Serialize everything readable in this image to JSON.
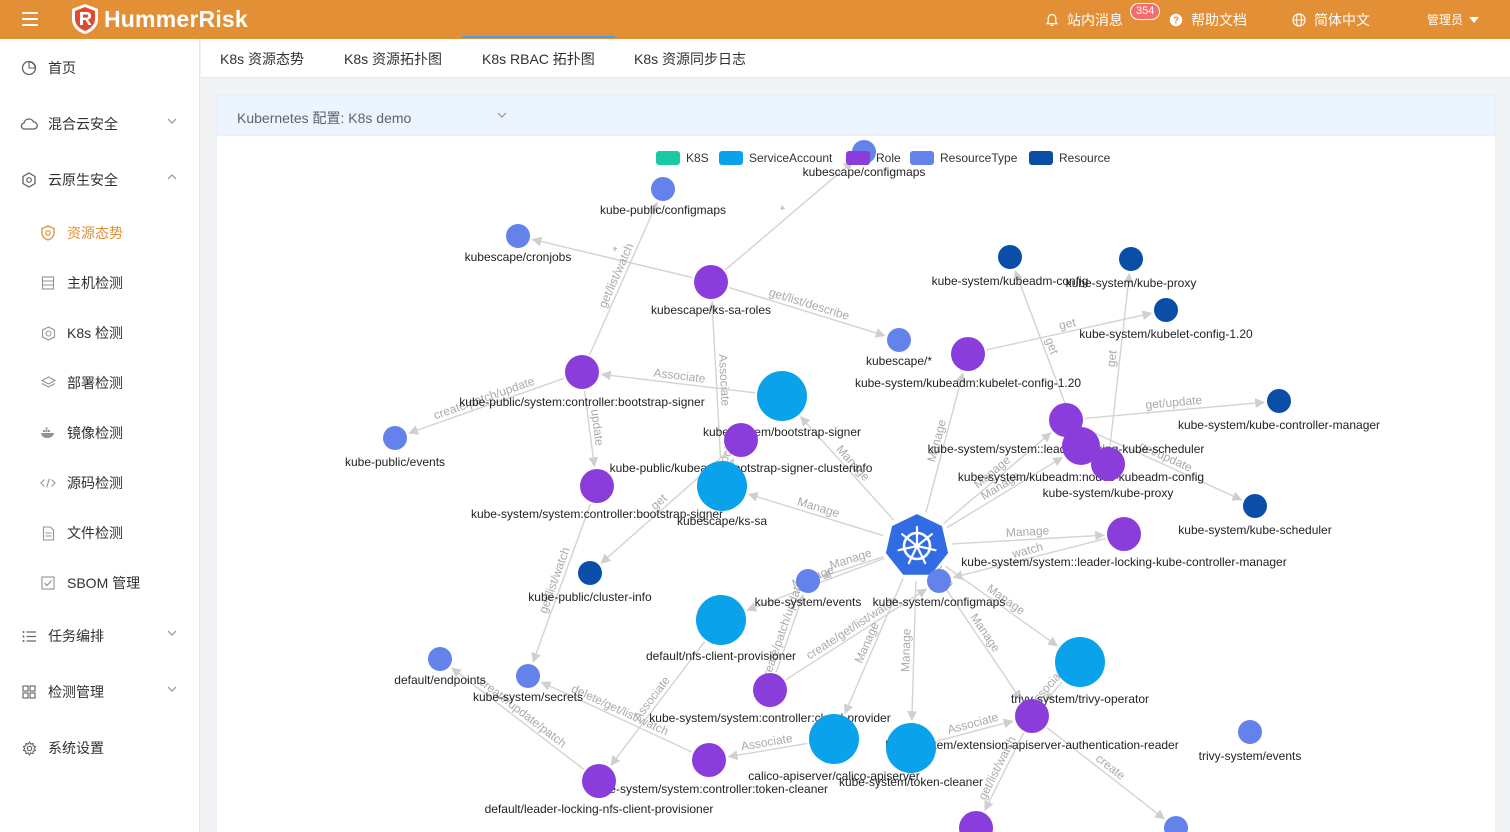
{
  "header": {
    "brand": "HummerRisk",
    "messages_label": "站内消息",
    "messages_badge": "354",
    "help_label": "帮助文档",
    "lang_label": "简体中文",
    "user_label": "管理员"
  },
  "sidebar": {
    "items": [
      {
        "label": "首页",
        "icon": "home-icon"
      },
      {
        "label": "混合云安全",
        "icon": "cloud-icon"
      },
      {
        "label": "云原生安全",
        "icon": "cloud-native-icon"
      },
      {
        "label": "资源态势",
        "icon": "shield-icon",
        "active": true
      },
      {
        "label": "主机检测",
        "icon": "server-icon"
      },
      {
        "label": "K8s 检测",
        "icon": "k8s-icon"
      },
      {
        "label": "部署检测",
        "icon": "layers-icon"
      },
      {
        "label": "镜像检测",
        "icon": "docker-icon"
      },
      {
        "label": "源码检测",
        "icon": "code-icon"
      },
      {
        "label": "文件检测",
        "icon": "file-icon"
      },
      {
        "label": "SBOM 管理",
        "icon": "checkbox-icon"
      },
      {
        "label": "任务编排",
        "icon": "list-icon"
      },
      {
        "label": "检测管理",
        "icon": "grid-icon"
      },
      {
        "label": "系统设置",
        "icon": "gear-icon"
      }
    ]
  },
  "tabs": [
    {
      "label": "K8s 资源态势"
    },
    {
      "label": "K8s 资源拓扑图"
    },
    {
      "label": "K8s RBAC 拓扑图",
      "active": true
    },
    {
      "label": "K8s 资源同步日志"
    }
  ],
  "panel": {
    "config_label": "Kubernetes 配置: K8s demo"
  },
  "colors": {
    "header": "#e38f35",
    "K8S": "#1bc8a4",
    "ServiceAccount": "#0aa2ea",
    "Role": "#8a3ddb",
    "ResourceType": "#6482eb",
    "Resource": "#0a4ea8"
  },
  "graph": {
    "legend": [
      "K8S",
      "ServiceAccount",
      "Role",
      "ResourceType",
      "Resource"
    ],
    "nodes": [
      {
        "id": "k8s",
        "cat": "K8S",
        "label": ""
      },
      {
        "id": "kubescape-configmaps",
        "cat": "ResourceType",
        "label": "kubescape/configmaps"
      },
      {
        "id": "kube-public-configmaps",
        "cat": "ResourceType",
        "label": "kube-public/configmaps"
      },
      {
        "id": "kubescape-cronjobs",
        "cat": "ResourceType",
        "label": "kubescape/cronjobs"
      },
      {
        "id": "kubescape-ks-sa-roles",
        "cat": "Role",
        "label": "kubescape/ks-sa-roles"
      },
      {
        "id": "kubescape-star",
        "cat": "ResourceType",
        "label": "kubescape/*"
      },
      {
        "id": "kubeadm-kubelet-config",
        "cat": "Role",
        "label": "kube-system/kubeadm:kubelet-config-1.20"
      },
      {
        "id": "kube-system-kubeadm-config",
        "cat": "Resource",
        "label": "kube-system/kubeadm-config"
      },
      {
        "id": "kube-system-kube-proxy-res",
        "cat": "Resource",
        "label": "kube-system/kube-proxy"
      },
      {
        "id": "kube-system-kubelet-config",
        "cat": "Resource",
        "label": "kube-system/kubelet-config-1.20"
      },
      {
        "id": "bootstrap-signer-role",
        "cat": "Role",
        "label": "kube-public/system:controller:bootstrap-signer"
      },
      {
        "id": "kube-public-events",
        "cat": "ResourceType",
        "label": "kube-public/events"
      },
      {
        "id": "kube-system-bootstrap-signer",
        "cat": "ServiceAccount",
        "label": "kube-system/bootstrap-signer"
      },
      {
        "id": "bootstrap-signer-clusterinfo",
        "cat": "Role",
        "label": "kube-public/kubeadm:bootstrap-signer-clusterinfo"
      },
      {
        "id": "kube-system-bootstrap-signer-role",
        "cat": "Role",
        "label": "kube-system/system:controller:bootstrap-signer"
      },
      {
        "id": "kubescape-ks-sa",
        "cat": "ServiceAccount",
        "label": "kubescape/ks-sa"
      },
      {
        "id": "kube-public-cluster-info",
        "cat": "Resource",
        "label": "kube-public/cluster-info"
      },
      {
        "id": "leader-locking-kube-scheduler",
        "cat": "Role",
        "label": "kube-system/system::leader-locking-kube-scheduler"
      },
      {
        "id": "kubeadm-nodes-config",
        "cat": "Role",
        "label": "kube-system/kubeadm:nodes-kubeadm-config"
      },
      {
        "id": "kube-system-kube-proxy-role",
        "cat": "Role",
        "label": "kube-system/kube-proxy"
      },
      {
        "id": "kube-controller-manager",
        "cat": "Resource",
        "label": "kube-system/kube-controller-manager"
      },
      {
        "id": "kube-scheduler",
        "cat": "Resource",
        "label": "kube-system/kube-scheduler"
      },
      {
        "id": "leader-locking-kcm",
        "cat": "Role",
        "label": "kube-system/system::leader-locking-kube-controller-manager"
      },
      {
        "id": "kube-system-events",
        "cat": "ResourceType",
        "label": "kube-system/events"
      },
      {
        "id": "kube-system-configmaps",
        "cat": "ResourceType",
        "label": "kube-system/configmaps"
      },
      {
        "id": "nfs-client-provisioner",
        "cat": "ServiceAccount",
        "label": "default/nfs-client-provisioner"
      },
      {
        "id": "default-endpoints",
        "cat": "ResourceType",
        "label": "default/endpoints"
      },
      {
        "id": "kube-system-secrets",
        "cat": "ResourceType",
        "label": "kube-system/secrets"
      },
      {
        "id": "cloud-provider",
        "cat": "Role",
        "label": "kube-system/system:controller:cloud-provider"
      },
      {
        "id": "trivy-operator",
        "cat": "ServiceAccount",
        "label": "trivy-system/trivy-operator"
      },
      {
        "id": "extension-apiserver-auth",
        "cat": "Role",
        "label": "kube-system/extension-apiserver-authentication-reader"
      },
      {
        "id": "calico-apiserver",
        "cat": "ServiceAccount",
        "label": "calico-apiserver/calico-apiserver"
      },
      {
        "id": "token-cleaner",
        "cat": "ServiceAccount",
        "label": "kube-system/token-cleaner"
      },
      {
        "id": "token-cleaner-role",
        "cat": "Role",
        "label": "kube-system/system:controller:token-cleaner"
      },
      {
        "id": "leader-locking-nfs",
        "cat": "Role",
        "label": "default/leader-locking-nfs-client-provisioner"
      },
      {
        "id": "trivy-events",
        "cat": "ResourceType",
        "label": "trivy-system/events"
      },
      {
        "id": "bottom-role-1",
        "cat": "Role",
        "label": ""
      },
      {
        "id": "bottom-resourcetype-1",
        "cat": "ResourceType",
        "label": ""
      }
    ],
    "edges": [
      {
        "from": "kubescape-ks-sa-roles",
        "to": "kubescape-configmaps",
        "label": "*"
      },
      {
        "from": "kubescape-ks-sa-roles",
        "to": "kubescape-cronjobs",
        "label": "*"
      },
      {
        "from": "kubescape-ks-sa-roles",
        "to": "kubescape-star",
        "label": "get/list/describe"
      },
      {
        "from": "bootstrap-signer-role",
        "to": "kube-public-configmaps",
        "label": "get/list/watch"
      },
      {
        "from": "bootstrap-signer-role",
        "to": "kube-public-events",
        "label": "create/patch/update"
      },
      {
        "from": "kube-system-bootstrap-signer",
        "to": "bootstrap-signer-role",
        "label": "Associate"
      },
      {
        "from": "kubescape-ks-sa",
        "to": "kubescape-ks-sa-roles",
        "label": "Associate"
      },
      {
        "from": "kubescape-ks-sa",
        "to": "bootstrap-signer-clusterinfo",
        "label": "Associate"
      },
      {
        "from": "kubeadm-kubelet-config",
        "to": "kube-system-kubelet-config",
        "label": "get"
      },
      {
        "from": "kubeadm-nodes-config",
        "to": "kube-system-kubeadm-config",
        "label": "get"
      },
      {
        "from": "kube-system-kube-proxy-role",
        "to": "kube-system-kube-proxy-res",
        "label": "get"
      },
      {
        "from": "bootstrap-signer-role",
        "to": "kube-system-bootstrap-signer-role",
        "label": "update"
      },
      {
        "from": "bootstrap-signer-clusterinfo",
        "to": "kube-public-cluster-info",
        "label": "get"
      },
      {
        "from": "kube-system-bootstrap-signer-role",
        "to": "kube-system-secrets",
        "label": "get/list/watch"
      },
      {
        "from": "k8s",
        "to": "kube-system-bootstrap-signer",
        "label": "Manage"
      },
      {
        "from": "k8s",
        "to": "kubescape-ks-sa",
        "label": "Manage"
      },
      {
        "from": "k8s",
        "to": "kubeadm-kubelet-config",
        "label": "Manage"
      },
      {
        "from": "k8s",
        "to": "leader-locking-kube-scheduler",
        "label": "Manage"
      },
      {
        "from": "k8s",
        "to": "kubeadm-nodes-config",
        "label": "Manage"
      },
      {
        "from": "k8s",
        "to": "leader-locking-kcm",
        "label": "Manage"
      },
      {
        "from": "k8s",
        "to": "kube-system-events",
        "label": "Manage"
      },
      {
        "from": "k8s",
        "to": "nfs-client-provisioner",
        "label": "Manage"
      },
      {
        "from": "k8s",
        "to": "calico-apiserver",
        "label": "Manage"
      },
      {
        "from": "k8s",
        "to": "token-cleaner",
        "label": "Manage"
      },
      {
        "from": "k8s",
        "to": "trivy-operator",
        "label": "Manage"
      },
      {
        "from": "k8s",
        "to": "extension-apiserver-auth",
        "label": "Manage"
      },
      {
        "from": "leader-locking-kcm",
        "to": "kube-system-configmaps",
        "label": "watch"
      },
      {
        "from": "leader-locking-kube-scheduler",
        "to": "kube-scheduler",
        "label": "get/update"
      },
      {
        "from": "leader-locking-kube-scheduler",
        "to": "kube-controller-manager",
        "label": "get/update"
      },
      {
        "from": "cloud-provider",
        "to": "kube-system-events",
        "label": "create/patch/update"
      },
      {
        "from": "cloud-provider",
        "to": "kube-system-configmaps",
        "label": "create/get/list/watch"
      },
      {
        "from": "token-cleaner",
        "to": "extension-apiserver-auth",
        "label": "Associate"
      },
      {
        "from": "calico-apiserver",
        "to": "token-cleaner-role",
        "label": "Associate"
      },
      {
        "from": "token-cleaner-role",
        "to": "kube-system-secrets",
        "label": "delete/get/list/watch"
      },
      {
        "from": "leader-locking-nfs",
        "to": "default-endpoints",
        "label": "create/update/patch"
      },
      {
        "from": "nfs-client-provisioner",
        "to": "leader-locking-nfs",
        "label": "Associate"
      },
      {
        "from": "trivy-operator",
        "to": "extension-apiserver-auth",
        "label": "Associate"
      },
      {
        "from": "extension-apiserver-auth",
        "to": "bottom-role-1",
        "label": "get/list/watch"
      },
      {
        "from": "extension-apiserver-auth",
        "to": "bottom-resourcetype-1",
        "label": "create"
      },
      {
        "from": "k8s",
        "to": "kube-system-configmaps",
        "label": "Manage"
      }
    ],
    "edge_extra_labels": [
      "create/get/list/watch",
      "Associate"
    ]
  }
}
